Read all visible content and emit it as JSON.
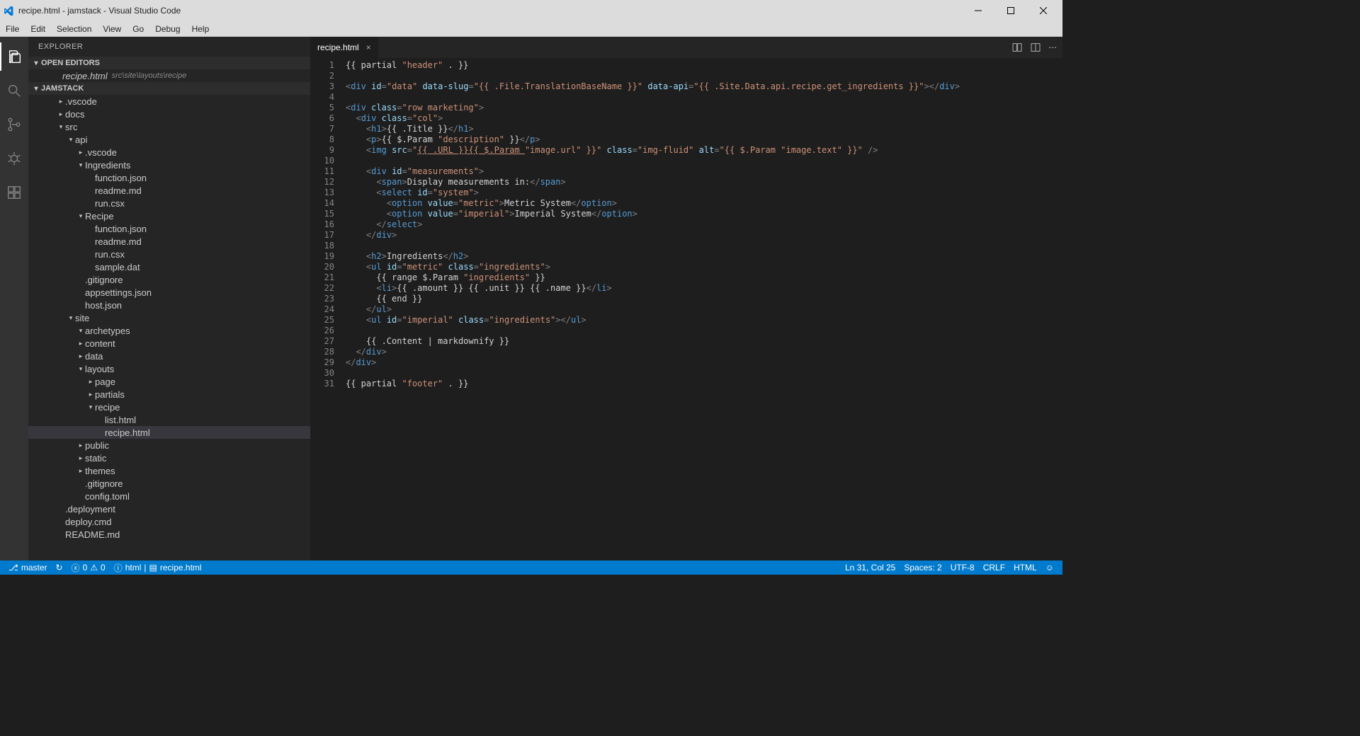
{
  "window": {
    "title": "recipe.html - jamstack - Visual Studio Code"
  },
  "menu": [
    "File",
    "Edit",
    "Selection",
    "View",
    "Go",
    "Debug",
    "Help"
  ],
  "explorer": {
    "title": "EXPLORER",
    "open_editors_label": "OPEN EDITORS",
    "open_editor_file": "recipe.html",
    "open_editor_path": "src\\site\\layouts\\recipe",
    "project_label": "JAMSTACK",
    "tree": [
      {
        "d": 0,
        "t": "folder",
        "o": false,
        "n": ".vscode"
      },
      {
        "d": 0,
        "t": "folder",
        "o": false,
        "n": "docs"
      },
      {
        "d": 0,
        "t": "folder",
        "o": true,
        "n": "src"
      },
      {
        "d": 1,
        "t": "folder",
        "o": true,
        "n": "api"
      },
      {
        "d": 2,
        "t": "folder",
        "o": false,
        "n": ".vscode"
      },
      {
        "d": 2,
        "t": "folder",
        "o": true,
        "n": "Ingredients"
      },
      {
        "d": 3,
        "t": "file",
        "n": "function.json"
      },
      {
        "d": 3,
        "t": "file",
        "n": "readme.md"
      },
      {
        "d": 3,
        "t": "file",
        "n": "run.csx"
      },
      {
        "d": 2,
        "t": "folder",
        "o": true,
        "n": "Recipe"
      },
      {
        "d": 3,
        "t": "file",
        "n": "function.json"
      },
      {
        "d": 3,
        "t": "file",
        "n": "readme.md"
      },
      {
        "d": 3,
        "t": "file",
        "n": "run.csx"
      },
      {
        "d": 3,
        "t": "file",
        "n": "sample.dat"
      },
      {
        "d": 2,
        "t": "file",
        "n": ".gitignore"
      },
      {
        "d": 2,
        "t": "file",
        "n": "appsettings.json"
      },
      {
        "d": 2,
        "t": "file",
        "n": "host.json"
      },
      {
        "d": 1,
        "t": "folder",
        "o": true,
        "n": "site"
      },
      {
        "d": 2,
        "t": "folder",
        "o": true,
        "n": "archetypes"
      },
      {
        "d": 2,
        "t": "folder",
        "o": false,
        "n": "content"
      },
      {
        "d": 2,
        "t": "folder",
        "o": false,
        "n": "data"
      },
      {
        "d": 2,
        "t": "folder",
        "o": true,
        "n": "layouts"
      },
      {
        "d": 3,
        "t": "folder",
        "o": false,
        "n": "page"
      },
      {
        "d": 3,
        "t": "folder",
        "o": false,
        "n": "partials"
      },
      {
        "d": 3,
        "t": "folder",
        "o": true,
        "n": "recipe"
      },
      {
        "d": 4,
        "t": "file",
        "n": "list.html"
      },
      {
        "d": 4,
        "t": "file",
        "n": "recipe.html",
        "sel": true
      },
      {
        "d": 2,
        "t": "folder",
        "o": false,
        "n": "public"
      },
      {
        "d": 2,
        "t": "folder",
        "o": false,
        "n": "static"
      },
      {
        "d": 2,
        "t": "folder",
        "o": false,
        "n": "themes"
      },
      {
        "d": 2,
        "t": "file",
        "n": ".gitignore"
      },
      {
        "d": 2,
        "t": "file",
        "n": "config.toml"
      },
      {
        "d": 0,
        "t": "file",
        "n": ".deployment"
      },
      {
        "d": 0,
        "t": "file",
        "n": "deploy.cmd"
      },
      {
        "d": 0,
        "t": "file",
        "n": "README.md"
      }
    ]
  },
  "tab": {
    "name": "recipe.html"
  },
  "code_lines": [
    [
      [
        "txt",
        "{{ partial "
      ],
      [
        "str",
        "\"header\""
      ],
      [
        "txt",
        " . }}"
      ]
    ],
    [],
    [
      [
        "pun",
        "<"
      ],
      [
        "tag",
        "div"
      ],
      [
        "txt",
        " "
      ],
      [
        "attr",
        "id"
      ],
      [
        "pun",
        "="
      ],
      [
        "str",
        "\"data\""
      ],
      [
        "txt",
        " "
      ],
      [
        "attr",
        "data-slug"
      ],
      [
        "pun",
        "="
      ],
      [
        "str",
        "\"{{ .File.TranslationBaseName }}\""
      ],
      [
        "txt",
        " "
      ],
      [
        "attr",
        "data-api"
      ],
      [
        "pun",
        "="
      ],
      [
        "str",
        "\"{{ .Site.Data.api.recipe.get_ingredients }}\""
      ],
      [
        "pun",
        "></"
      ],
      [
        "tag",
        "div"
      ],
      [
        "pun",
        ">"
      ]
    ],
    [],
    [
      [
        "pun",
        "<"
      ],
      [
        "tag",
        "div"
      ],
      [
        "txt",
        " "
      ],
      [
        "attr",
        "class"
      ],
      [
        "pun",
        "="
      ],
      [
        "str",
        "\"row marketing\""
      ],
      [
        "pun",
        ">"
      ]
    ],
    [
      [
        "txt",
        "  "
      ],
      [
        "pun",
        "<"
      ],
      [
        "tag",
        "div"
      ],
      [
        "txt",
        " "
      ],
      [
        "attr",
        "class"
      ],
      [
        "pun",
        "="
      ],
      [
        "str",
        "\"col\""
      ],
      [
        "pun",
        ">"
      ]
    ],
    [
      [
        "txt",
        "    "
      ],
      [
        "pun",
        "<"
      ],
      [
        "tag",
        "h1"
      ],
      [
        "pun",
        ">"
      ],
      [
        "txt",
        "{{ .Title }}"
      ],
      [
        "pun",
        "</"
      ],
      [
        "tag",
        "h1"
      ],
      [
        "pun",
        ">"
      ]
    ],
    [
      [
        "txt",
        "    "
      ],
      [
        "pun",
        "<"
      ],
      [
        "tag",
        "p"
      ],
      [
        "pun",
        ">"
      ],
      [
        "txt",
        "{{ $.Param "
      ],
      [
        "str",
        "\"description\""
      ],
      [
        "txt",
        " }}"
      ],
      [
        "pun",
        "</"
      ],
      [
        "tag",
        "p"
      ],
      [
        "pun",
        ">"
      ]
    ],
    [
      [
        "txt",
        "    "
      ],
      [
        "pun",
        "<"
      ],
      [
        "tag",
        "img"
      ],
      [
        "txt",
        " "
      ],
      [
        "attr",
        "src"
      ],
      [
        "pun",
        "="
      ],
      [
        "str",
        "\""
      ],
      [
        "url",
        "{{ .URL }}{{ $.Param "
      ],
      [
        "str",
        "\"image.url\" }}\""
      ],
      [
        "txt",
        " "
      ],
      [
        "attr",
        "class"
      ],
      [
        "pun",
        "="
      ],
      [
        "str",
        "\"img-fluid\""
      ],
      [
        "txt",
        " "
      ],
      [
        "attr",
        "alt"
      ],
      [
        "pun",
        "="
      ],
      [
        "str",
        "\"{{ $.Param \"image.text\" }}\""
      ],
      [
        "txt",
        " "
      ],
      [
        "pun",
        "/>"
      ]
    ],
    [],
    [
      [
        "txt",
        "    "
      ],
      [
        "pun",
        "<"
      ],
      [
        "tag",
        "div"
      ],
      [
        "txt",
        " "
      ],
      [
        "attr",
        "id"
      ],
      [
        "pun",
        "="
      ],
      [
        "str",
        "\"measurements\""
      ],
      [
        "pun",
        ">"
      ]
    ],
    [
      [
        "txt",
        "      "
      ],
      [
        "pun",
        "<"
      ],
      [
        "tag",
        "span"
      ],
      [
        "pun",
        ">"
      ],
      [
        "txt",
        "Display measurements in:"
      ],
      [
        "pun",
        "</"
      ],
      [
        "tag",
        "span"
      ],
      [
        "pun",
        ">"
      ]
    ],
    [
      [
        "txt",
        "      "
      ],
      [
        "pun",
        "<"
      ],
      [
        "tag",
        "select"
      ],
      [
        "txt",
        " "
      ],
      [
        "attr",
        "id"
      ],
      [
        "pun",
        "="
      ],
      [
        "str",
        "\"system\""
      ],
      [
        "pun",
        ">"
      ]
    ],
    [
      [
        "txt",
        "        "
      ],
      [
        "pun",
        "<"
      ],
      [
        "tag",
        "option"
      ],
      [
        "txt",
        " "
      ],
      [
        "attr",
        "value"
      ],
      [
        "pun",
        "="
      ],
      [
        "str",
        "\"metric\""
      ],
      [
        "pun",
        ">"
      ],
      [
        "txt",
        "Metric System"
      ],
      [
        "pun",
        "</"
      ],
      [
        "tag",
        "option"
      ],
      [
        "pun",
        ">"
      ]
    ],
    [
      [
        "txt",
        "        "
      ],
      [
        "pun",
        "<"
      ],
      [
        "tag",
        "option"
      ],
      [
        "txt",
        " "
      ],
      [
        "attr",
        "value"
      ],
      [
        "pun",
        "="
      ],
      [
        "str",
        "\"imperial\""
      ],
      [
        "pun",
        ">"
      ],
      [
        "txt",
        "Imperial System"
      ],
      [
        "pun",
        "</"
      ],
      [
        "tag",
        "option"
      ],
      [
        "pun",
        ">"
      ]
    ],
    [
      [
        "txt",
        "      "
      ],
      [
        "pun",
        "</"
      ],
      [
        "tag",
        "select"
      ],
      [
        "pun",
        ">"
      ]
    ],
    [
      [
        "txt",
        "    "
      ],
      [
        "pun",
        "</"
      ],
      [
        "tag",
        "div"
      ],
      [
        "pun",
        ">"
      ]
    ],
    [],
    [
      [
        "txt",
        "    "
      ],
      [
        "pun",
        "<"
      ],
      [
        "tag",
        "h2"
      ],
      [
        "pun",
        ">"
      ],
      [
        "txt",
        "Ingredients"
      ],
      [
        "pun",
        "</"
      ],
      [
        "tag",
        "h2"
      ],
      [
        "pun",
        ">"
      ]
    ],
    [
      [
        "txt",
        "    "
      ],
      [
        "pun",
        "<"
      ],
      [
        "tag",
        "ul"
      ],
      [
        "txt",
        " "
      ],
      [
        "attr",
        "id"
      ],
      [
        "pun",
        "="
      ],
      [
        "str",
        "\"metric\""
      ],
      [
        "txt",
        " "
      ],
      [
        "attr",
        "class"
      ],
      [
        "pun",
        "="
      ],
      [
        "str",
        "\"ingredients\""
      ],
      [
        "pun",
        ">"
      ]
    ],
    [
      [
        "txt",
        "      {{ range $.Param "
      ],
      [
        "str",
        "\"ingredients\""
      ],
      [
        "txt",
        " }}"
      ]
    ],
    [
      [
        "txt",
        "      "
      ],
      [
        "pun",
        "<"
      ],
      [
        "tag",
        "li"
      ],
      [
        "pun",
        ">"
      ],
      [
        "txt",
        "{{ .amount }} {{ .unit }} {{ .name }}"
      ],
      [
        "pun",
        "</"
      ],
      [
        "tag",
        "li"
      ],
      [
        "pun",
        ">"
      ]
    ],
    [
      [
        "txt",
        "      {{ end }}"
      ]
    ],
    [
      [
        "txt",
        "    "
      ],
      [
        "pun",
        "</"
      ],
      [
        "tag",
        "ul"
      ],
      [
        "pun",
        ">"
      ]
    ],
    [
      [
        "txt",
        "    "
      ],
      [
        "pun",
        "<"
      ],
      [
        "tag",
        "ul"
      ],
      [
        "txt",
        " "
      ],
      [
        "attr",
        "id"
      ],
      [
        "pun",
        "="
      ],
      [
        "str",
        "\"imperial\""
      ],
      [
        "txt",
        " "
      ],
      [
        "attr",
        "class"
      ],
      [
        "pun",
        "="
      ],
      [
        "str",
        "\"ingredients\""
      ],
      [
        "pun",
        "></"
      ],
      [
        "tag",
        "ul"
      ],
      [
        "pun",
        ">"
      ]
    ],
    [],
    [
      [
        "txt",
        "    {{ .Content | markdownify }}"
      ]
    ],
    [
      [
        "txt",
        "  "
      ],
      [
        "pun",
        "</"
      ],
      [
        "tag",
        "div"
      ],
      [
        "pun",
        ">"
      ]
    ],
    [
      [
        "pun",
        "</"
      ],
      [
        "tag",
        "div"
      ],
      [
        "pun",
        ">"
      ]
    ],
    [],
    [
      [
        "txt",
        "{{ partial "
      ],
      [
        "str",
        "\"footer\""
      ],
      [
        "txt",
        " . }}"
      ]
    ]
  ],
  "status": {
    "branch_icon": "⎇",
    "branch": "master",
    "sync_icon": "↻",
    "errors": "0",
    "warnings": "0",
    "lang_left": "html",
    "file_left": "recipe.html",
    "cursor": "Ln 31, Col 25",
    "spaces": "Spaces: 2",
    "encoding": "UTF-8",
    "eol": "CRLF",
    "lang": "HTML",
    "smile": "☺"
  }
}
